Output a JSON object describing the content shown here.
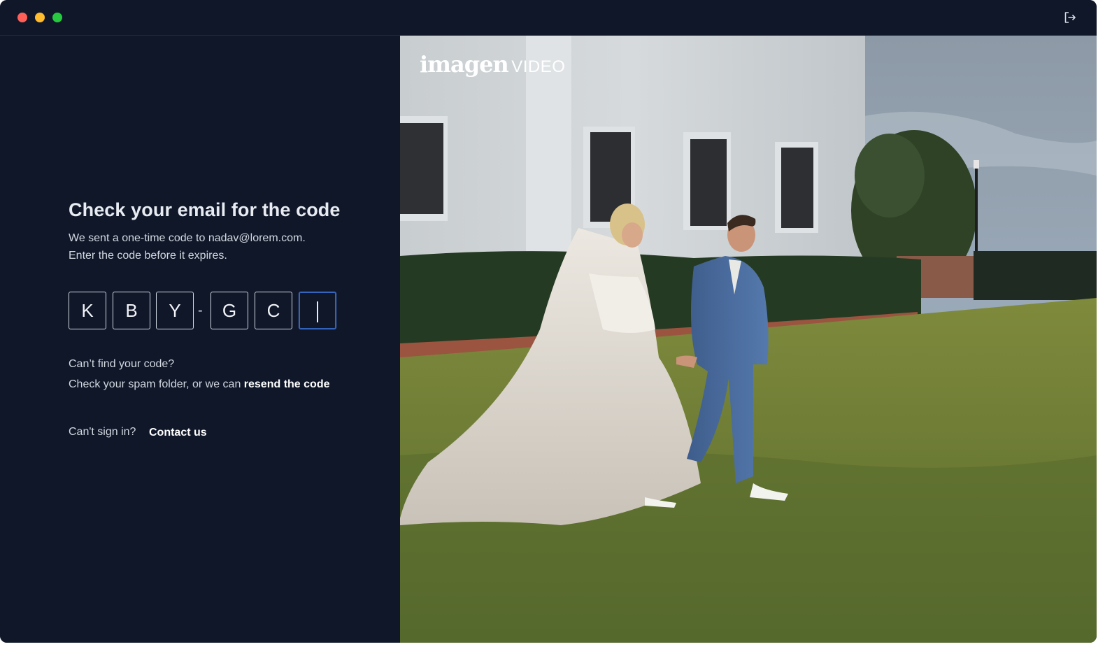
{
  "window": {
    "controls": [
      "close",
      "minimize",
      "maximize"
    ],
    "signout_icon": "sign-out-icon"
  },
  "verify": {
    "heading": "Check your email for the code",
    "line1": "We sent a one-time code to nadav@lorem.com.",
    "line2": "Enter the code before it expires.",
    "code": [
      "K",
      "B",
      "Y",
      "G",
      "C",
      ""
    ],
    "separator": "-",
    "help_question": "Can’t find your code?",
    "help_text": "Check your spam folder, or we can ",
    "resend_link": "resend the code",
    "cant_sign_in": "Can't sign in?",
    "contact_link": "Contact us"
  },
  "brand": {
    "logo_main": "imagen",
    "logo_sub": "VIDEO"
  },
  "colors": {
    "background": "#0f1729",
    "input_border": "#d6dbe3",
    "active_border": "#4b7bd9"
  }
}
